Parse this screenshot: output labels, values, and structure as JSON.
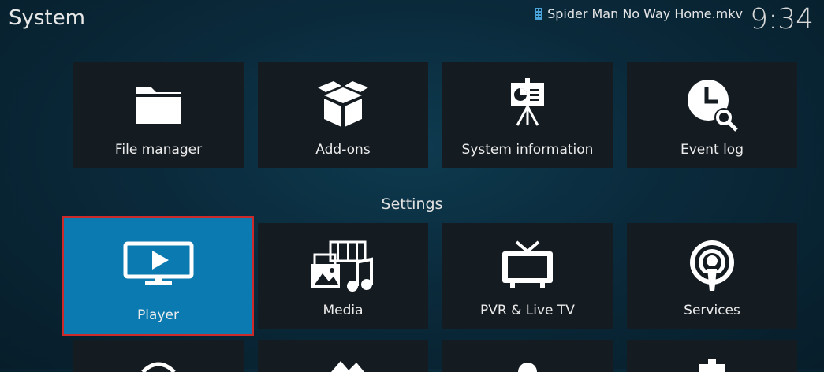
{
  "header": {
    "title": "System",
    "now_playing": "Spider Man No Way Home.mkv",
    "clock": "9:34"
  },
  "top_row": [
    {
      "label": "File manager",
      "icon": "folder-icon"
    },
    {
      "label": "Add-ons",
      "icon": "box-icon"
    },
    {
      "label": "System information",
      "icon": "presentation-icon"
    },
    {
      "label": "Event log",
      "icon": "clock-search-icon"
    }
  ],
  "section": {
    "label": "Settings"
  },
  "settings_row": [
    {
      "label": "Player",
      "icon": "monitor-play-icon",
      "focused": true
    },
    {
      "label": "Media",
      "icon": "media-icon"
    },
    {
      "label": "PVR & Live TV",
      "icon": "tv-icon"
    },
    {
      "label": "Services",
      "icon": "broadcast-icon"
    }
  ],
  "colors": {
    "focus": "#0a7ab0",
    "focus_outline": "#cc2a2a",
    "tile": "#141b21"
  }
}
